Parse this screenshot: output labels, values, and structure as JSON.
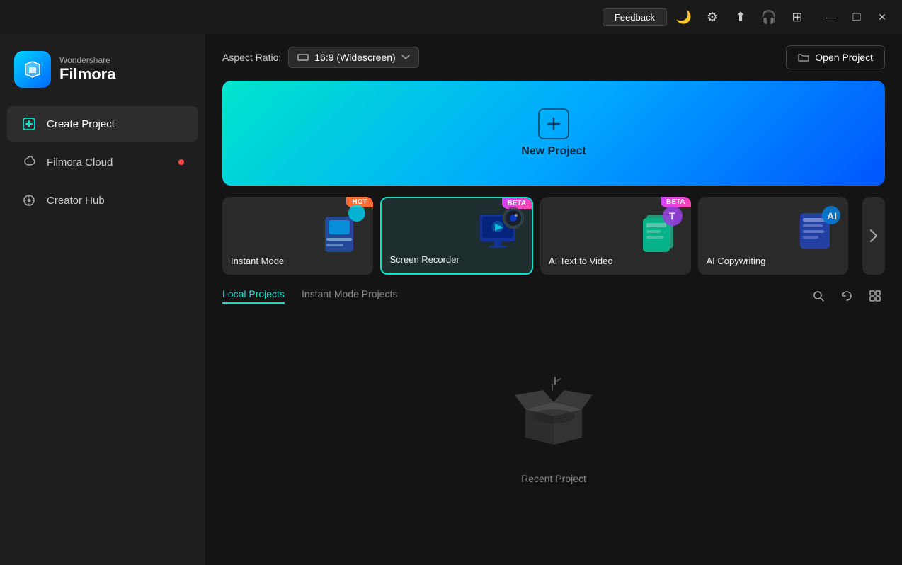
{
  "titlebar": {
    "feedback_label": "Feedback",
    "minimize_label": "—",
    "maximize_label": "❐",
    "close_label": "✕"
  },
  "sidebar": {
    "brand": "Wondershare",
    "product": "Filmora",
    "nav_items": [
      {
        "id": "create-project",
        "label": "Create Project",
        "active": true,
        "badge": false
      },
      {
        "id": "filmora-cloud",
        "label": "Filmora Cloud",
        "active": false,
        "badge": true
      },
      {
        "id": "creator-hub",
        "label": "Creator Hub",
        "active": false,
        "badge": false
      }
    ]
  },
  "main": {
    "aspect_ratio_label": "Aspect Ratio:",
    "aspect_ratio_value": "16:9 (Widescreen)",
    "open_project_label": "Open Project",
    "new_project_label": "New Project",
    "feature_cards": [
      {
        "id": "instant-mode",
        "label": "Instant Mode",
        "badge": "HOT",
        "badge_type": "hot"
      },
      {
        "id": "screen-recorder",
        "label": "Screen Recorder",
        "badge": "BETA",
        "badge_type": "beta",
        "selected": true
      },
      {
        "id": "ai-text-to-video",
        "label": "AI Text to Video",
        "badge": "BETA",
        "badge_type": "beta"
      },
      {
        "id": "ai-copywriting",
        "label": "AI Copywriting",
        "badge": "",
        "badge_type": ""
      }
    ],
    "tabs": [
      {
        "id": "local-projects",
        "label": "Local Projects",
        "active": true
      },
      {
        "id": "instant-mode-projects",
        "label": "Instant Mode Projects",
        "active": false
      }
    ],
    "empty_state_label": "Recent Project"
  }
}
